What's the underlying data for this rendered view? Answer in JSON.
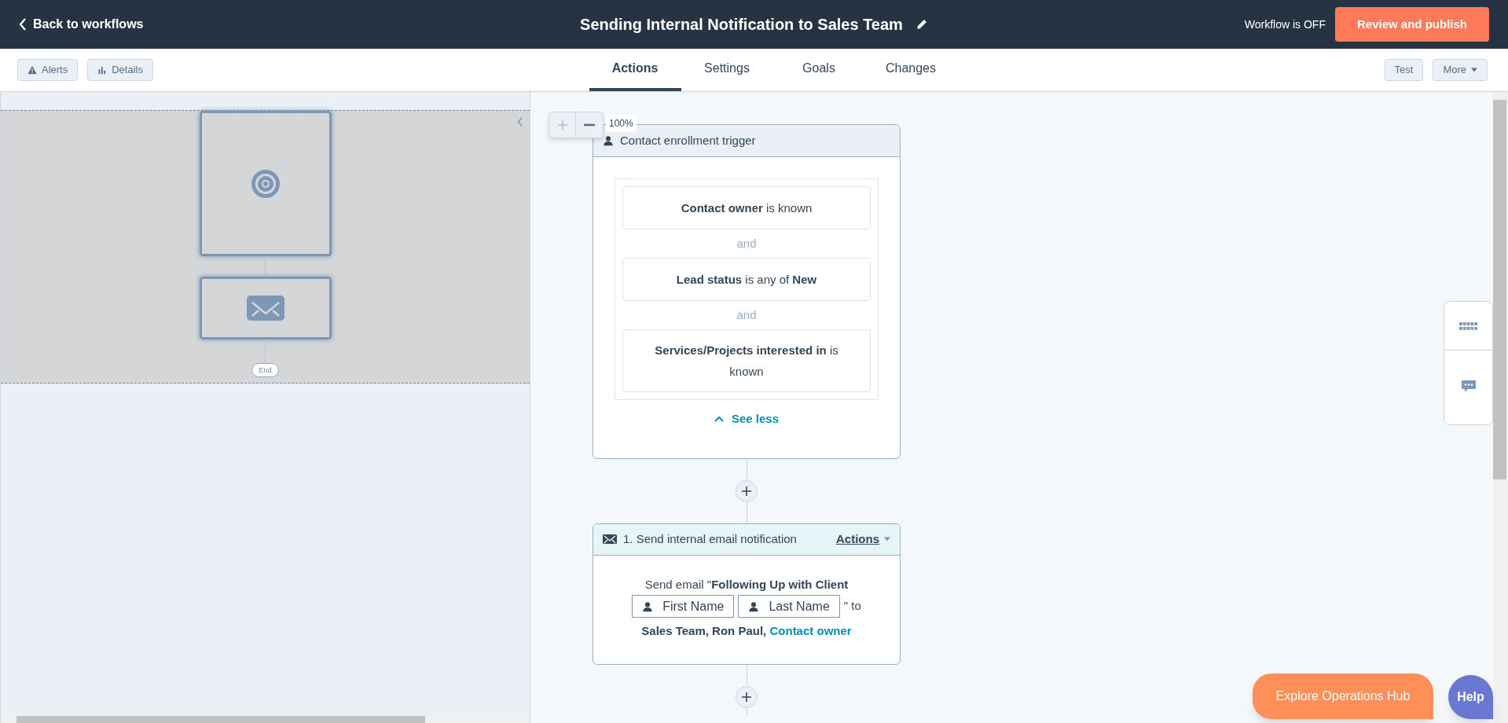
{
  "header": {
    "back_link": "Back to workflows",
    "title": "Sending Internal Notification to Sales Team",
    "status": "Workflow is OFF",
    "publish_button": "Review and publish"
  },
  "toolbar": {
    "left_buttons": [
      {
        "kind": "alert",
        "label": "Alerts"
      },
      {
        "kind": "chart",
        "label": "Details"
      }
    ],
    "tabs": [
      {
        "label": "Actions",
        "selected": true
      },
      {
        "label": "Settings",
        "selected": false
      },
      {
        "label": "Goals",
        "selected": false
      },
      {
        "label": "Changes",
        "selected": false
      }
    ],
    "right_buttons": [
      {
        "kind": "plain",
        "label": "Test"
      },
      {
        "kind": "dropdown",
        "label": "More"
      }
    ]
  },
  "minimap": {
    "nodes": [
      {
        "kind": "trigger"
      },
      {
        "kind": "email"
      }
    ],
    "end_label": "End"
  },
  "zoom": {
    "level_label": "100%"
  },
  "trigger": {
    "title": "Contact enrollment trigger",
    "conditions": [
      "**Contact owner** is known",
      "**Lead status** is any of **New**",
      "**Services/Projects interested in** is known"
    ],
    "joiners": [
      "and",
      "and"
    ],
    "toggle": "See less"
  },
  "action": {
    "title": "1. Send internal email notification",
    "menu": "Actions",
    "line": "Send email \"**Following Up with Client**",
    "tokens": [
      "First Name",
      "Last Name"
    ],
    "after_tokens": "\" to",
    "recipients": "**Sales Team, Ron Paul,**",
    "recipient_link": "Contact owner"
  },
  "floating": {
    "explore_button": "Explore Operations Hub",
    "help_button": "Help"
  }
}
